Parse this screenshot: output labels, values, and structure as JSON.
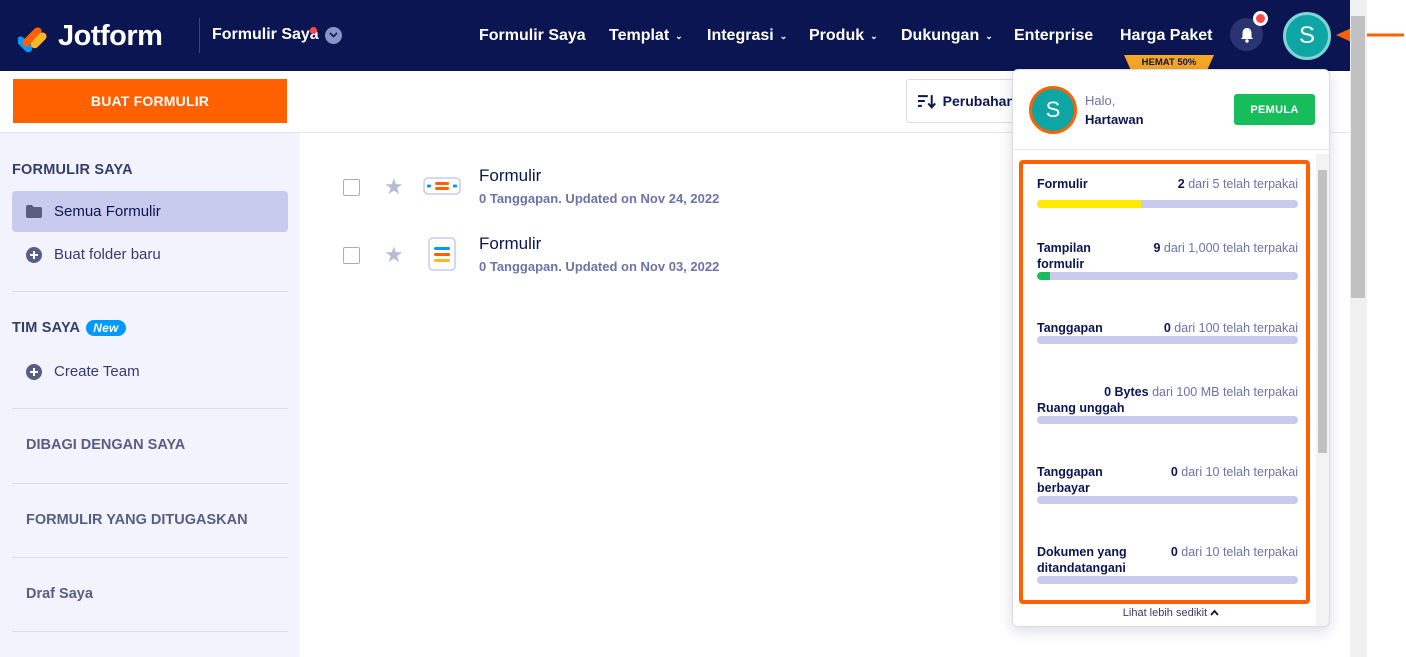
{
  "brand": {
    "name": "Jotform"
  },
  "switcher": {
    "label": "Formulir Saya"
  },
  "nav": {
    "items": [
      {
        "label": "Formulir Saya",
        "caret": false
      },
      {
        "label": "Templat",
        "caret": true
      },
      {
        "label": "Integrasi",
        "caret": true
      },
      {
        "label": "Produk",
        "caret": true
      },
      {
        "label": "Dukungan",
        "caret": true
      },
      {
        "label": "Enterprise",
        "caret": false
      },
      {
        "label": "Harga Paket",
        "caret": false
      }
    ],
    "pricing_badge": "HEMAT 50%",
    "avatar_initial": "S"
  },
  "toolbar": {
    "create_label": "BUAT FORMULIR",
    "sort_label": "Perubahan"
  },
  "sidebar": {
    "my_forms_heading": "FORMULIR SAYA",
    "all_forms": "Semua Formulir",
    "new_folder": "Buat folder baru",
    "team_heading": "TIM SAYA",
    "new_badge": "New",
    "create_team": "Create Team",
    "shared": "DIBAGI DENGAN SAYA",
    "assigned": "FORMULIR YANG DITUGASKAN",
    "drafts": "Draf Saya"
  },
  "forms": [
    {
      "title": "Formulir",
      "meta": "0 Tanggapan. Updated on Nov 24, 2022"
    },
    {
      "title": "Formulir",
      "meta": "0 Tanggapan. Updated on Nov 03, 2022"
    }
  ],
  "account": {
    "greeting": "Halo,",
    "name": "Hartawan",
    "plan": "PEMULA",
    "avatar_initial": "S",
    "usage": [
      {
        "label": "Formulir",
        "count": "2",
        "limit": "dari 5 telah terpakai",
        "fraction": 0.4,
        "color": "#ffea00"
      },
      {
        "label": "Tampilan formulir",
        "count": "9",
        "limit": "dari 1,000 telah terpakai",
        "fraction": 0.009,
        "color": "#18bd5b"
      },
      {
        "label": "Tanggapan",
        "count": "0",
        "limit": "dari 100 telah terpakai",
        "fraction": 0,
        "color": "#18bd5b"
      },
      {
        "label": "Ruang unggah",
        "count": "0 Bytes",
        "limit": "dari 100 MB telah terpakai",
        "fraction": 0,
        "color": "#18bd5b"
      },
      {
        "label": "Tanggapan berbayar",
        "count": "0",
        "limit": "dari 10 telah terpakai",
        "fraction": 0,
        "color": "#18bd5b"
      },
      {
        "label": "Dokumen yang ditandatangani",
        "count": "0",
        "limit": "dari 10 telah terpakai",
        "fraction": 0,
        "color": "#18bd5b"
      }
    ],
    "show_less": "Lihat lebih sedikit"
  },
  "colors": {
    "navy": "#0a1551",
    "orange": "#ff6100",
    "green": "#18bd5b",
    "teal": "#0ea5a5"
  }
}
